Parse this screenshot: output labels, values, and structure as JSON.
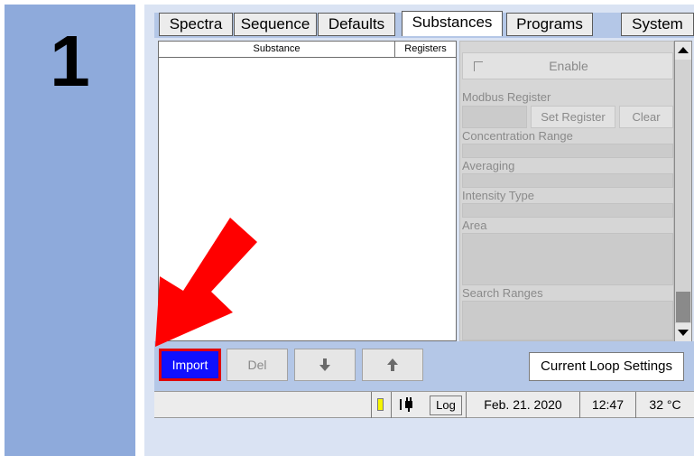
{
  "step": {
    "number": "1"
  },
  "tabs": [
    {
      "label": "Spectra"
    },
    {
      "label": "Sequence"
    },
    {
      "label": "Defaults"
    },
    {
      "label": "Substances",
      "active": true
    },
    {
      "label": "Programs"
    },
    {
      "label": "System"
    }
  ],
  "substances_table": {
    "columns": [
      "Substance",
      "Registers"
    ],
    "rows": []
  },
  "properties": {
    "enable_label": "Enable",
    "enable_checked": false,
    "modbus_register_label": "Modbus Register",
    "set_register_label": "Set Register",
    "clear_label": "Clear",
    "concentration_range_label": "Concentration Range",
    "averaging_label": "Averaging",
    "intensity_type_label": "Intensity Type",
    "area_label": "Area",
    "search_ranges_label": "Search Ranges"
  },
  "buttons": {
    "import_label": "Import",
    "del_label": "Del",
    "move_down_icon": "arrow-down-icon",
    "move_up_icon": "arrow-up-icon",
    "current_loop_label": "Current Loop Settings"
  },
  "status": {
    "log_label": "Log",
    "date": "Feb. 21. 2020",
    "time": "12:47",
    "temperature": "32 °C"
  },
  "colors": {
    "step_panel": "#8eaadb",
    "toolbar_bg": "#b4c7e7",
    "import_button": "#1010ff",
    "highlight_border": "#e00000",
    "annotation_arrow": "#ff0000",
    "status_led": "#f6f600"
  }
}
